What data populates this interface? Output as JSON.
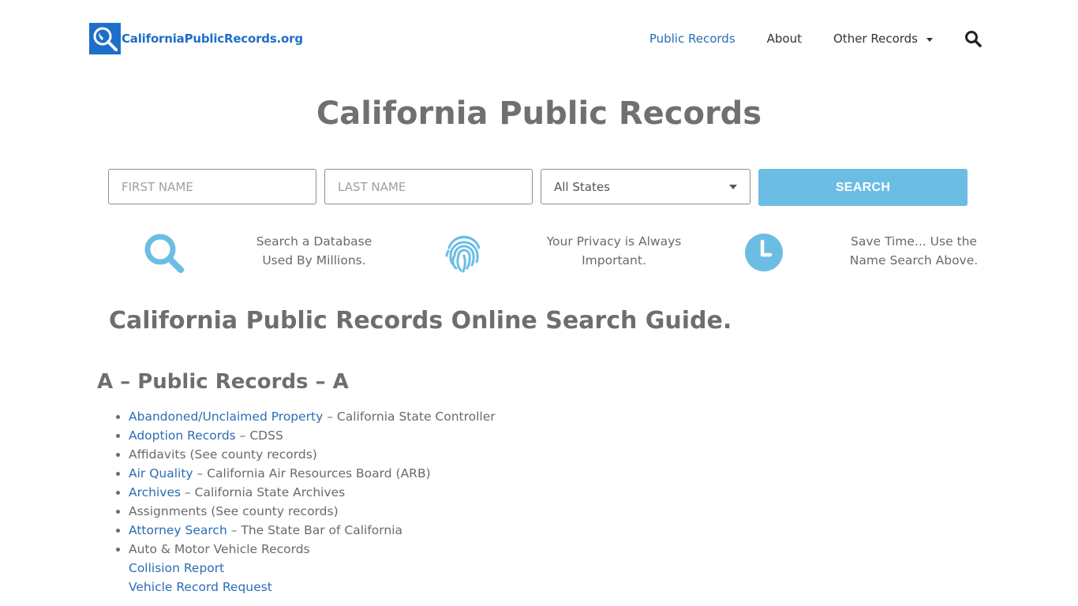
{
  "header": {
    "logo_text": "CaliforniaPublicRecords.org",
    "nav": [
      {
        "label": "Public Records",
        "active": true
      },
      {
        "label": "About"
      },
      {
        "label": "Other Records",
        "has_dropdown": true
      }
    ]
  },
  "page_title": "California Public Records",
  "search": {
    "first_name_placeholder": "FIRST NAME",
    "last_name_placeholder": "LAST NAME",
    "state_selected": "All States",
    "button_label": "SEARCH"
  },
  "features": [
    {
      "icon": "magnifier-icon",
      "line1": "Search a Database",
      "line2": "Used By Millions."
    },
    {
      "icon": "fingerprint-icon",
      "line1": "Your Privacy is Always",
      "line2": "Important."
    },
    {
      "icon": "clock-icon",
      "line1": "Save Time... Use the",
      "line2": "Name Search Above."
    }
  ],
  "guide_title": "California Public Records Online Search Guide.",
  "section_title": "A – Public Records – A",
  "records": [
    {
      "link": "Abandoned/Unclaimed Property",
      "suffix": " – California State Controller"
    },
    {
      "link": "Adoption Records",
      "suffix": " – CDSS"
    },
    {
      "text": "Affidavits (See county records)"
    },
    {
      "link": "Air Quality",
      "suffix": " – California Air Resources Board (ARB)"
    },
    {
      "link": "Archives",
      "suffix": " – California State Archives"
    },
    {
      "text": "Assignments (See county records)"
    },
    {
      "link": "Attorney Search",
      "suffix": " – The State Bar of California"
    },
    {
      "text": "Auto & Motor Vehicle Records"
    },
    {
      "sublink": "Collision Report"
    },
    {
      "sublink": "Vehicle Record Request"
    }
  ],
  "colors": {
    "brand": "#1e6fc9",
    "link": "#2a6db5",
    "accent": "#6bbde4",
    "heading": "#707070"
  }
}
